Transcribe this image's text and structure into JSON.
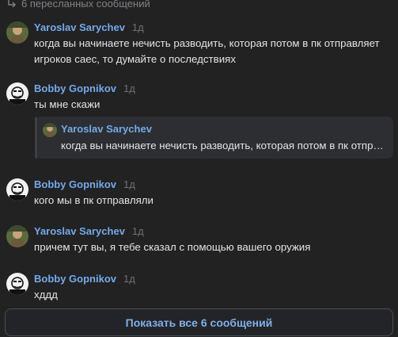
{
  "header": {
    "label": "6 пересланных сообщений"
  },
  "messages": [
    {
      "author": "Yaroslav Sarychev",
      "time": "1д",
      "text": "когда вы начинаете нечисть разводить, которая потом в пк отправляет игроков саес, то думайте о последствиях"
    },
    {
      "author": "Bobby Gopnikov",
      "time": "1д",
      "text": "ты мне скажи"
    },
    {
      "author": "Bobby Gopnikov",
      "time": "1д",
      "text": "кого мы в пк отправляли"
    },
    {
      "author": "Yaroslav Sarychev",
      "time": "1д",
      "text": "причем тут вы, я тебе сказал с помощью вашего оружия"
    },
    {
      "author": "Bobby Gopnikov",
      "time": "1д",
      "text": "хддд"
    }
  ],
  "reply": {
    "author": "Yaroslav Sarychev",
    "text": "когда вы начинаете нечисть разводить, которая потом в пк отправляет игроков саес, то думайте о последствиях"
  },
  "show_all": {
    "label": "Показать все 6 сообщений"
  },
  "colors": {
    "author": "#71aaeb",
    "background": "#222222",
    "button_text": "#7fb0e8"
  },
  "icons": {
    "header": "forward-icon",
    "avatar_yaroslav": "photo-avatar",
    "avatar_bobby": "caricature-avatar"
  }
}
